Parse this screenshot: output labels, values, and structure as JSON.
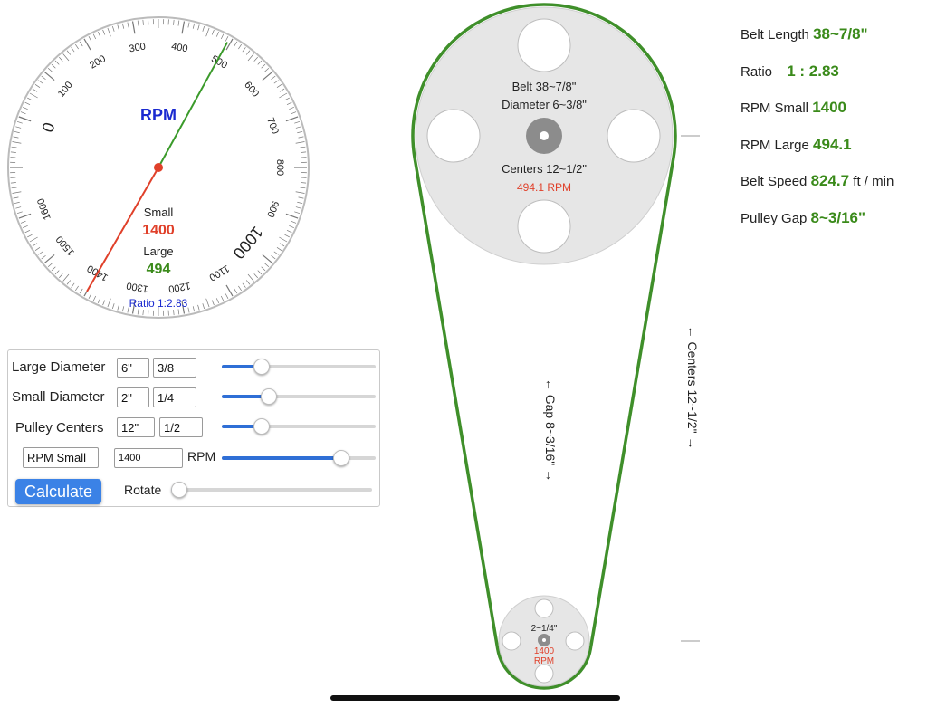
{
  "gauge": {
    "title": "RPM",
    "small_label": "Small",
    "small_value": "1400",
    "large_label": "Large",
    "large_value": "494",
    "ratio_text": "Ratio 1:2.83",
    "scale_labels": [
      "0",
      "100",
      "200",
      "300",
      "400",
      "500",
      "600",
      "700",
      "800",
      "900",
      "1000",
      "1100",
      "1200",
      "1300",
      "1400",
      "1500",
      "1600"
    ],
    "small_rpm": 1400,
    "large_rpm": 494.1
  },
  "controls": {
    "large_diameter": {
      "label": "Large Diameter",
      "inches": "6\"",
      "fraction": "3/8",
      "slider_level": 0.23
    },
    "small_diameter": {
      "label": "Small Diameter",
      "inches": "2\"",
      "fraction": "1/4",
      "slider_level": 0.28
    },
    "pulley_centers": {
      "label": "Pulley Centers",
      "inches": "12\"",
      "fraction": "1/2",
      "slider_level": 0.23
    },
    "rpm": {
      "select_value": "RPM Small",
      "value": "1400",
      "unit": "RPM",
      "slider_level": 0.81
    },
    "calculate_label": "Calculate",
    "rotate": {
      "label": "Rotate",
      "slider_level": 0.0
    }
  },
  "results": {
    "belt_length": {
      "label": "Belt Length",
      "value": "38~7/8\""
    },
    "ratio": {
      "label": "Ratio",
      "value": "1 : 2.83"
    },
    "rpm_small": {
      "label": "RPM Small",
      "value": "1400"
    },
    "rpm_large": {
      "label": "RPM Large",
      "value": "494.1"
    },
    "belt_speed": {
      "label": "Belt Speed",
      "value": "824.7",
      "unit": "ft / min"
    },
    "pulley_gap": {
      "label": "Pulley Gap",
      "value": "8~3/16\""
    }
  },
  "diagram": {
    "large": {
      "belt": "Belt 38~7/8\"",
      "diameter": "Diameter 6~3/8\"",
      "centers": "Centers 12~1/2\"",
      "rpm": "494.1 RPM"
    },
    "small": {
      "diameter": "2~1/4\"",
      "rpm_value": "1400",
      "rpm_unit": "RPM"
    },
    "gap_text": "← Gap 8~3/16\" →",
    "centers_text": "← Centers 12~1/2\" →"
  },
  "colors": {
    "belt": "#3f8f2a",
    "small_needle": "#e0402a",
    "large_needle": "#3a9a2a",
    "rpm_red": "#e0402a",
    "value_green": "#3a8a1a",
    "title_blue": "#1a2ad0",
    "button_blue": "#3b82e6",
    "pulley_fill": "#e6e6e6"
  }
}
